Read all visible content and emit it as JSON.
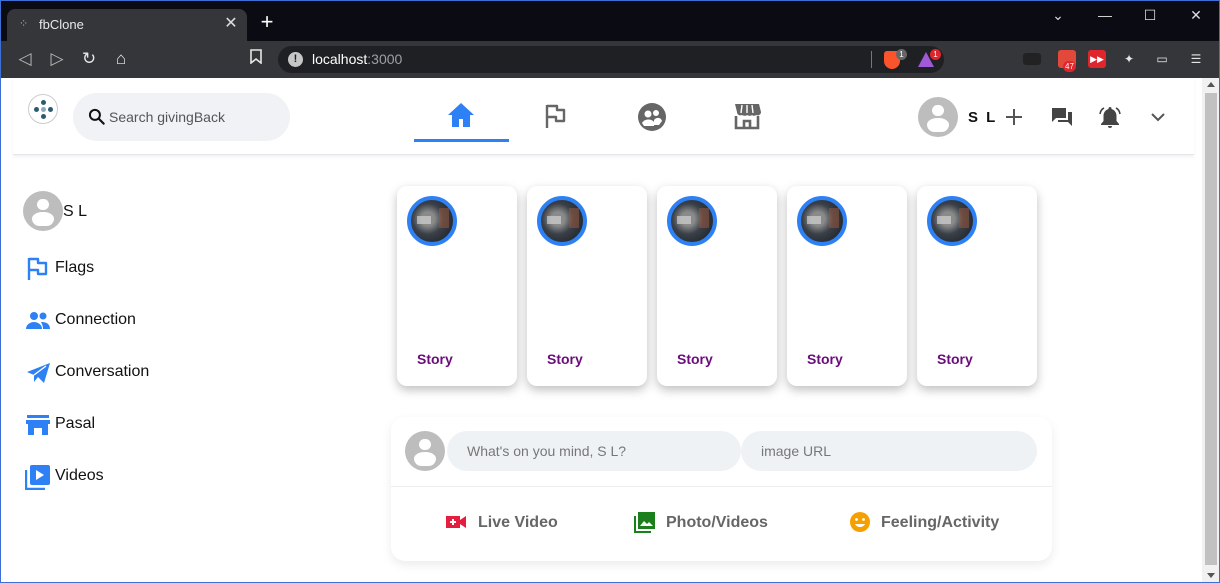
{
  "browser": {
    "tab_title": "fbClone",
    "tab_close": "✕",
    "new_tab": "+",
    "window_controls": {
      "minimize": "—",
      "maximize": "☐",
      "close": "✕",
      "tabs_menu": "⌄"
    },
    "url_host": "localhost",
    "url_port": ":3000",
    "brave_badge": "1",
    "rewards_badge": "1",
    "extension_badge": "47"
  },
  "header": {
    "search_placeholder": "Search givingBack",
    "user_name": "S L",
    "nav_tabs": [
      {
        "name": "home",
        "active": true
      },
      {
        "name": "flag",
        "active": false
      },
      {
        "name": "groups",
        "active": false
      },
      {
        "name": "store",
        "active": false
      }
    ]
  },
  "sidebar": {
    "items": [
      {
        "label": "S L",
        "icon": "avatar"
      },
      {
        "label": "Flags",
        "icon": "flag-icon"
      },
      {
        "label": "Connection",
        "icon": "people-icon"
      },
      {
        "label": "Conversation",
        "icon": "send-icon"
      },
      {
        "label": "Pasal",
        "icon": "store-icon"
      },
      {
        "label": "Videos",
        "icon": "video-library-icon"
      }
    ]
  },
  "stories": [
    {
      "label": "Story"
    },
    {
      "label": "Story"
    },
    {
      "label": "Story"
    },
    {
      "label": "Story"
    },
    {
      "label": "Story"
    }
  ],
  "composer": {
    "message_placeholder": "What's on you mind, S L?",
    "image_placeholder": "image URL",
    "options": [
      {
        "label": "Live Video",
        "icon": "videocam-icon",
        "color": "#e41e3f"
      },
      {
        "label": "Photo/Videos",
        "icon": "photo-library-icon",
        "color": "#1b7f1b"
      },
      {
        "label": "Feeling/Activity",
        "icon": "emoji-icon",
        "color": "#f5a000"
      }
    ]
  },
  "colors": {
    "accent": "#2e81f4",
    "story_label": "#6a0d7a"
  }
}
